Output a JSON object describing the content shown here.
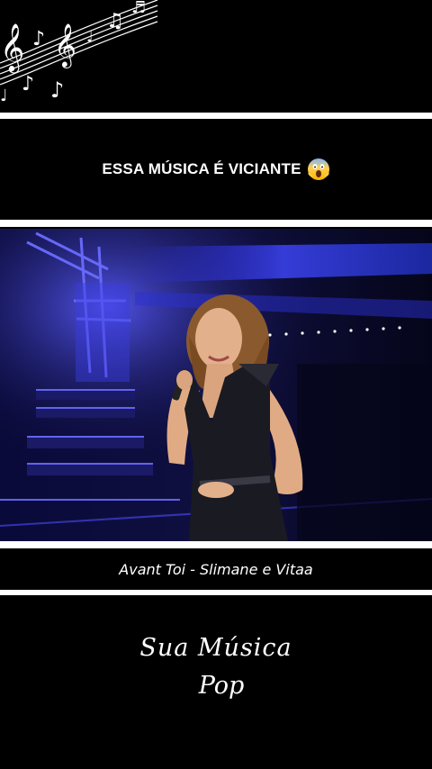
{
  "caption": {
    "text": "ESSA MÚSICA É VICIANTE",
    "emoji": "face-screaming-in-fear-icon"
  },
  "song": {
    "title": "Avant Toi - Slimane e Vitaa"
  },
  "brand": {
    "line1": "Sua Música",
    "line2": "Pop"
  },
  "colors": {
    "background": "#000000",
    "bars": "#ffffff",
    "stage_blue": "#2a2cff",
    "dress": "#1a1a22"
  },
  "icons": [
    "music-notes-decoration-icon",
    "face-screaming-in-fear-icon"
  ]
}
